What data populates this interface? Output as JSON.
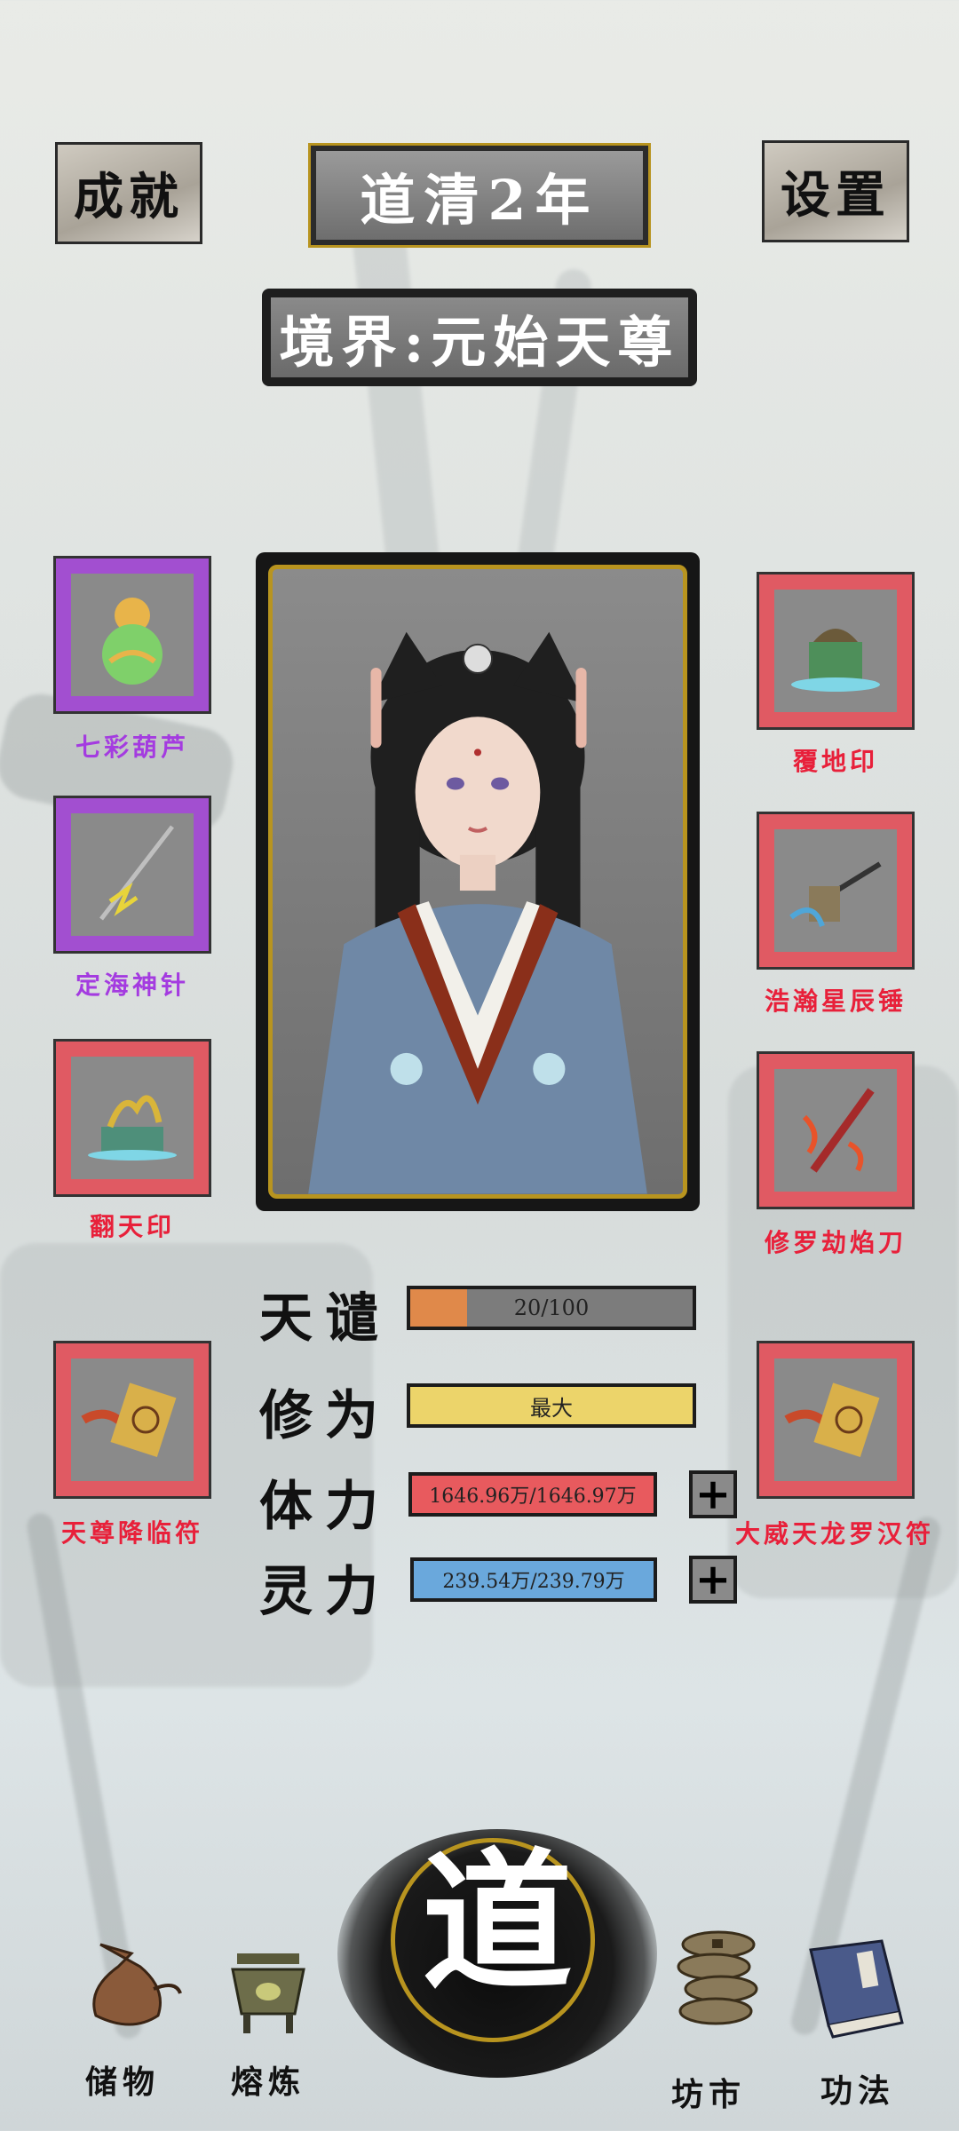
{
  "header": {
    "achievements_label": "成就",
    "year_label": "道清2年",
    "settings_label": "设置",
    "realm_label": "境界:元始天尊"
  },
  "left_items": [
    {
      "name": "七彩葫芦",
      "rarity": "purple",
      "icon": "gourd-icon"
    },
    {
      "name": "定海神针",
      "rarity": "purple",
      "icon": "spear-icon"
    },
    {
      "name": "翻天印",
      "rarity": "red",
      "icon": "dragon-seal-icon"
    },
    {
      "name": "天尊降临符",
      "rarity": "red",
      "icon": "talisman-icon"
    }
  ],
  "right_items": [
    {
      "name": "覆地印",
      "rarity": "red",
      "icon": "earth-seal-icon"
    },
    {
      "name": "浩瀚星辰锤",
      "rarity": "red",
      "icon": "hammer-icon"
    },
    {
      "name": "修罗劫焰刀",
      "rarity": "red",
      "icon": "flame-sword-icon"
    },
    {
      "name": "大威天龙罗汉符",
      "rarity": "red",
      "icon": "talisman-icon"
    }
  ],
  "stats": {
    "tribulation": {
      "label": "天谴",
      "value_text": "20/100",
      "fraction": 0.2,
      "color": "#e0894a"
    },
    "cultivation": {
      "label": "修为",
      "value_text": "最大",
      "fraction": 1.0,
      "color": "#ecd46a"
    },
    "stamina": {
      "label": "体力",
      "value_text": "1646.96万/1646.97万",
      "fraction": 1.0,
      "color": "#e85a5e"
    },
    "spirit": {
      "label": "灵力",
      "value_text": "239.54万/239.79万",
      "fraction": 1.0,
      "color": "#6aa8dc"
    }
  },
  "nav": {
    "storage": "储物",
    "refine": "熔炼",
    "dao": "道",
    "market": "坊市",
    "techniques": "功法"
  },
  "colors": {
    "gold": "#b8941f",
    "purple_rarity": "#a24fd0",
    "red_rarity": "#e05a63"
  }
}
